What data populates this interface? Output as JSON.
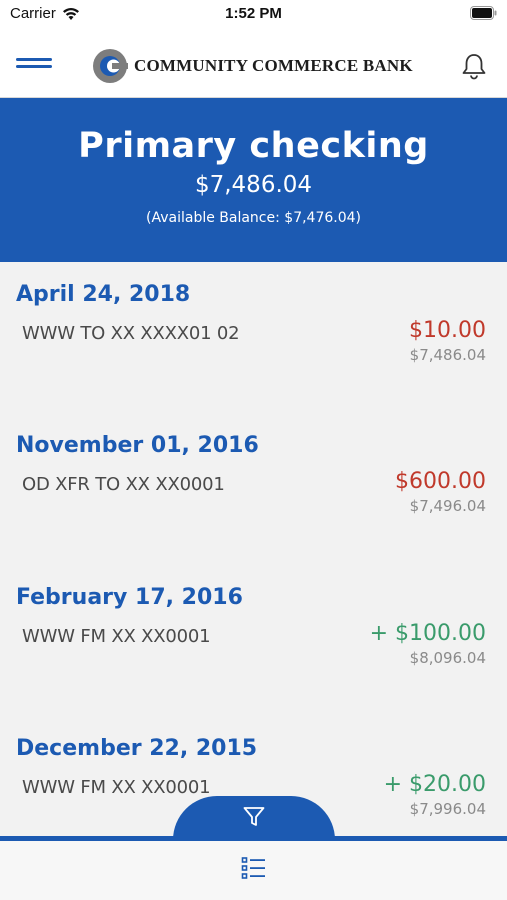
{
  "status_bar": {
    "carrier": "Carrier",
    "time": "1:52 PM",
    "icons": [
      "wifi-icon",
      "battery-icon"
    ]
  },
  "header": {
    "bank_name": "COMMUNITY COMMERCE BANK",
    "icons": [
      "hamburger-menu-icon",
      "bank-logo-icon",
      "bell-icon"
    ]
  },
  "account": {
    "name": "Primary checking",
    "balance": "$7,486.04",
    "available_text": "(Available Balance: $7,476.04)"
  },
  "transactions": [
    {
      "date": "April 24, 2018",
      "description": "WWW TO XX XXXX01 02",
      "amount": "$10.00",
      "type": "debit",
      "running_balance": "$7,486.04"
    },
    {
      "date": "November 01, 2016",
      "description": "OD XFR TO XX XX0001",
      "amount": "$600.00",
      "type": "debit",
      "running_balance": "$7,496.04"
    },
    {
      "date": "February 17, 2016",
      "description": "WWW FM XX XX0001",
      "amount": "+ $100.00",
      "type": "credit",
      "running_balance": "$8,096.04"
    },
    {
      "date": "December 22, 2015",
      "description": "WWW FM XX XX0001",
      "amount": "+ $20.00",
      "type": "credit",
      "running_balance": "$7,996.04"
    }
  ],
  "bottom_bar": {
    "icons": [
      "filter-icon",
      "list-icon"
    ]
  },
  "colors": {
    "brand_blue": "#1c5ab2",
    "debit_red": "#c0392b",
    "credit_green": "#3a9b6b"
  }
}
